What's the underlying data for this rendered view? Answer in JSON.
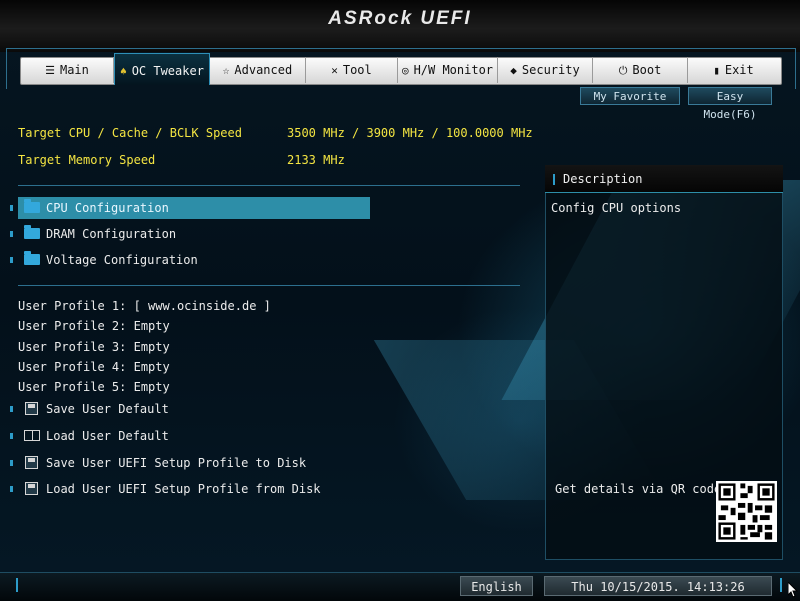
{
  "header": {
    "logo": "ASRock UEFI"
  },
  "tabs": [
    {
      "label": "Main",
      "icon": "list-icon",
      "active": false
    },
    {
      "label": "OC Tweaker",
      "icon": "flame-icon",
      "active": true
    },
    {
      "label": "Advanced",
      "icon": "star-icon",
      "active": false
    },
    {
      "label": "Tool",
      "icon": "tools-icon",
      "active": false
    },
    {
      "label": "H/W Monitor",
      "icon": "monitor-icon",
      "active": false
    },
    {
      "label": "Security",
      "icon": "shield-icon",
      "active": false
    },
    {
      "label": "Boot",
      "icon": "power-icon",
      "active": false
    },
    {
      "label": "Exit",
      "icon": "exit-icon",
      "active": false
    }
  ],
  "top_buttons": {
    "favorite": "My Favorite",
    "easy_mode": "Easy Mode(F6)"
  },
  "info": {
    "cpu_label": "Target CPU / Cache / BCLK Speed",
    "cpu_value": "3500 MHz / 3900 MHz / 100.0000 MHz",
    "mem_label": "Target Memory Speed",
    "mem_value": "2133 MHz"
  },
  "menu": [
    {
      "label": "CPU Configuration",
      "selected": true
    },
    {
      "label": "DRAM Configuration",
      "selected": false
    },
    {
      "label": "Voltage Configuration",
      "selected": false
    }
  ],
  "profiles": [
    "User Profile 1: [ www.ocinside.de ]",
    "User Profile 2: Empty",
    "User Profile 3: Empty",
    "User Profile 4: Empty",
    "User Profile 5: Empty"
  ],
  "actions": [
    {
      "label": "Save User Default",
      "icon": "save-icon"
    },
    {
      "label": "Load User Default",
      "icon": "book-icon"
    },
    {
      "label": "Save User UEFI Setup Profile to Disk",
      "icon": "save-disk-icon"
    },
    {
      "label": "Load User UEFI Setup Profile from Disk",
      "icon": "load-disk-icon"
    }
  ],
  "description": {
    "title": "Description",
    "text": "Config CPU options",
    "qr_label": "Get details via QR code"
  },
  "footer": {
    "language": "English",
    "datetime": "Thu 10/15/2015. 14:13:26"
  },
  "colors": {
    "accent": "#2d8ea8",
    "highlight_text": "#f4e542"
  }
}
